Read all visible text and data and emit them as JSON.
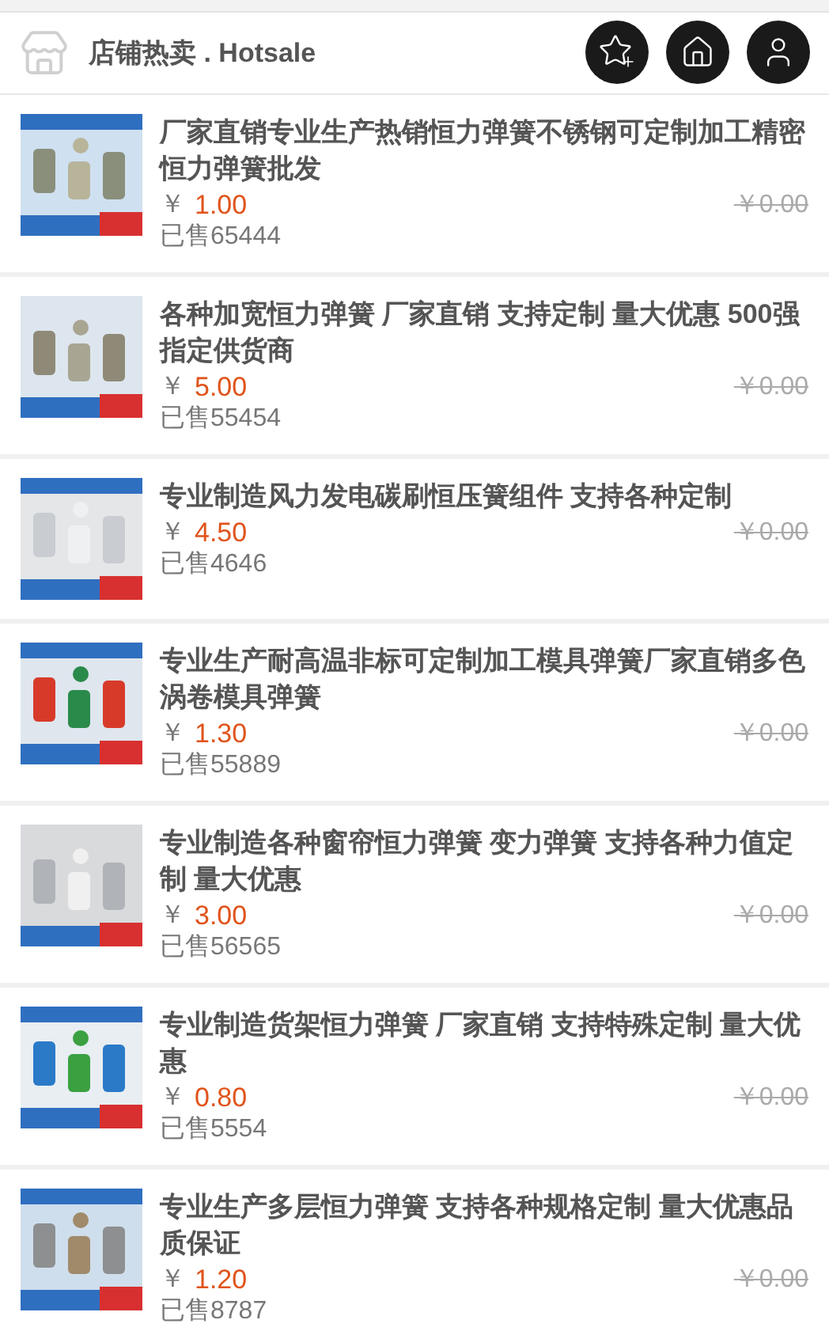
{
  "header": {
    "title": "店铺热卖 . Hotsale"
  },
  "products": [
    {
      "title": "厂家直销专业生产热销恒力弹簧不锈钢可定制加工精密恒力弹簧批发",
      "currency": "￥",
      "price": "1.00",
      "original_price": "￥0.00",
      "sold": "已售65444"
    },
    {
      "title": "各种加宽恒力弹簧 厂家直销 支持定制 量大优惠 500强指定供货商",
      "currency": "￥",
      "price": "5.00",
      "original_price": "￥0.00",
      "sold": "已售55454"
    },
    {
      "title": "专业制造风力发电碳刷恒压簧组件 支持各种定制",
      "currency": "￥",
      "price": "4.50",
      "original_price": "￥0.00",
      "sold": "已售4646"
    },
    {
      "title": "专业生产耐高温非标可定制加工模具弹簧厂家直销多色涡卷模具弹簧",
      "currency": "￥",
      "price": "1.30",
      "original_price": "￥0.00",
      "sold": "已售55889"
    },
    {
      "title": "专业制造各种窗帘恒力弹簧 变力弹簧 支持各种力值定制 量大优惠",
      "currency": "￥",
      "price": "3.00",
      "original_price": "￥0.00",
      "sold": "已售56565"
    },
    {
      "title": "专业制造货架恒力弹簧 厂家直销 支持特殊定制 量大优惠",
      "currency": "￥",
      "price": "0.80",
      "original_price": "￥0.00",
      "sold": "已售5554"
    },
    {
      "title": "专业生产多层恒力弹簧 支持各种规格定制 量大优惠品质保证",
      "currency": "￥",
      "price": "1.20",
      "original_price": "￥0.00",
      "sold": "已售8787"
    }
  ]
}
